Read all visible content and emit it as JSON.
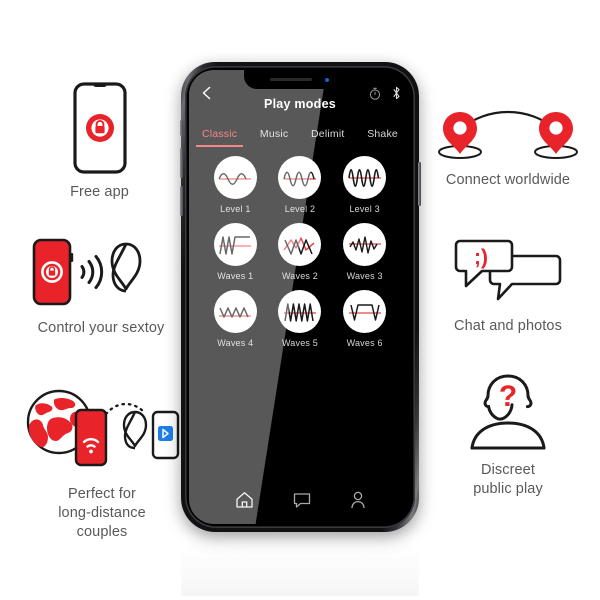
{
  "features": {
    "free_app": {
      "caption": "Free app",
      "icon": "phone-lock-icon"
    },
    "control": {
      "caption": "Control your sextoy",
      "icon": "phone-signal-toy-icon"
    },
    "long_dist": {
      "caption": "Perfect for\nlong-distance\ncouples",
      "icon": "globe-phone-toy-bluetooth-icon"
    },
    "connect": {
      "caption": "Connect worldwide",
      "icon": "map-pins-arc-icon"
    },
    "chat": {
      "caption": "Chat and photos",
      "icon": "speech-bubbles-icon",
      "emoticon": ";)"
    },
    "discreet": {
      "caption": "Discreet\npublic play",
      "icon": "person-question-icon",
      "glyph": "?"
    }
  },
  "phone": {
    "header": {
      "back_label": "back-arrow",
      "title": "Play modes",
      "timer_icon": "timer-icon",
      "bluetooth_icon": "bluetooth-icon"
    },
    "tabs": [
      {
        "label": "Classic",
        "active": true
      },
      {
        "label": "Music",
        "active": false
      },
      {
        "label": "Delimit",
        "active": false
      },
      {
        "label": "Shake",
        "active": false
      }
    ],
    "modes": [
      {
        "label": "Level 1",
        "wave": "gentle-sine"
      },
      {
        "label": "Level 2",
        "wave": "medium-sine"
      },
      {
        "label": "Level 3",
        "wave": "fast-sine"
      },
      {
        "label": "Waves 1",
        "wave": "spikes-plateau"
      },
      {
        "label": "Waves 2",
        "wave": "wide-zigzag"
      },
      {
        "label": "Waves 3",
        "wave": "ramp-zigzag"
      },
      {
        "label": "Waves 4",
        "wave": "small-zigzag"
      },
      {
        "label": "Waves 5",
        "wave": "dense-zigzag"
      },
      {
        "label": "Waves 6",
        "wave": "square-plateau"
      }
    ],
    "navbar": [
      {
        "icon": "home-icon",
        "label": "Home"
      },
      {
        "icon": "chat-icon",
        "label": "Chat"
      },
      {
        "icon": "profile-icon",
        "label": "Profile"
      }
    ]
  },
  "colors": {
    "brand_red": "#e8232a",
    "accent_red": "#ef4a4a",
    "caption_gray": "#58595b",
    "screen_black": "#000000"
  }
}
